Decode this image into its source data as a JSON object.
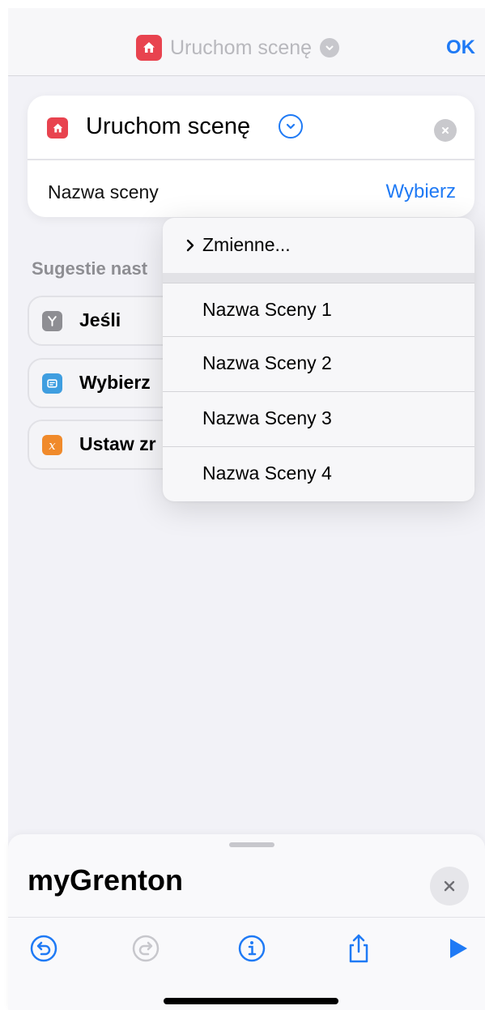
{
  "nav": {
    "title": "Uruchom scenę",
    "ok_label": "OK"
  },
  "action": {
    "title": "Uruchom scenę",
    "param_label": "Nazwa sceny",
    "param_value": "Wybierz"
  },
  "suggestions": {
    "title": "Sugestie nast",
    "items": [
      {
        "label": "Jeśli",
        "icon": "branch-icon",
        "color": "#8e8e93"
      },
      {
        "label": "Wybierz",
        "icon": "menu-list-icon",
        "color": "#3f9ee0"
      },
      {
        "label": "Ustaw zr",
        "icon": "variable-x-icon",
        "color": "#f08a2b"
      }
    ]
  },
  "menu": {
    "variables_label": "Zmienne...",
    "items": [
      "Nazwa Sceny 1",
      "Nazwa Sceny 2",
      "Nazwa Sceny 3",
      "Nazwa Sceny 4"
    ]
  },
  "sheet": {
    "title": "myGrenton"
  },
  "colors": {
    "accent": "#1f7af5",
    "home_app": "#e8434f"
  }
}
